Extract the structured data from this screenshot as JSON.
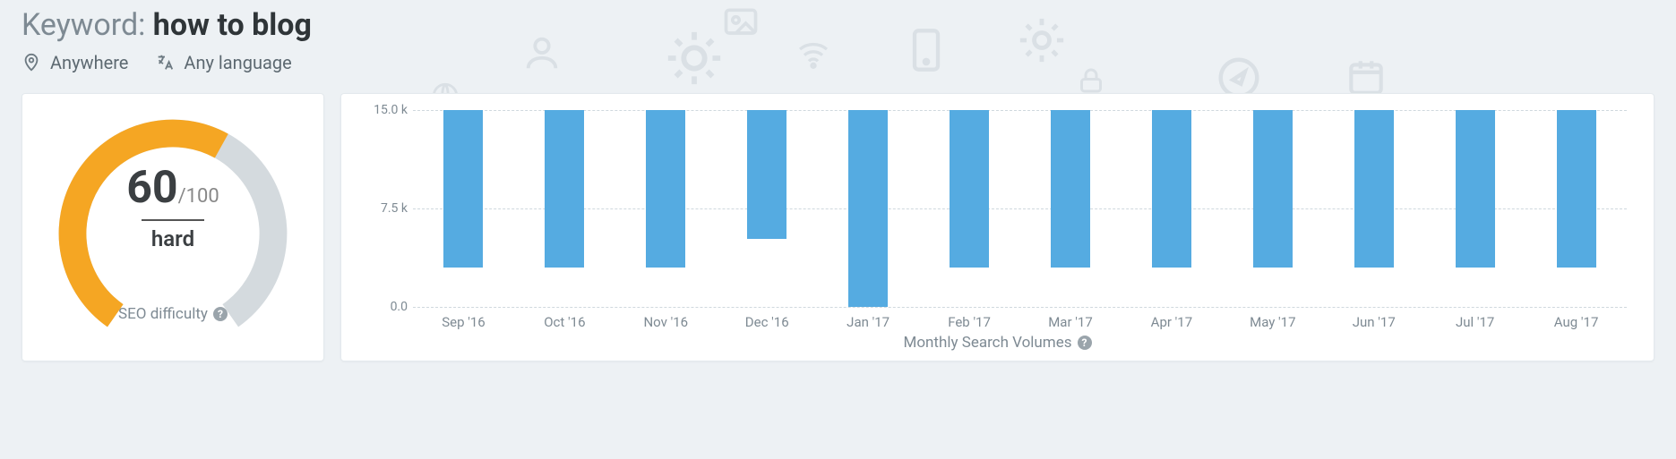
{
  "header": {
    "title_prefix": "Keyword: ",
    "keyword": "how to blog",
    "location_label": "Anywhere",
    "language_label": "Any language"
  },
  "gauge": {
    "score": "60",
    "max_suffix": "/100",
    "label": "hard",
    "caption": "SEO difficulty",
    "percent": 0.6
  },
  "chart": {
    "caption": "Monthly Search Volumes",
    "yticks": [
      {
        "v": 0.0,
        "label": "0.0"
      },
      {
        "v": 7.5,
        "label": "7.5 k"
      },
      {
        "v": 15.0,
        "label": "15.0 k"
      }
    ],
    "ymax": 15.0
  },
  "chart_data": {
    "type": "bar",
    "title": "Monthly Search Volumes",
    "xlabel": "",
    "ylabel": "",
    "ylim": [
      0,
      15
    ],
    "unit": "k",
    "categories": [
      "Sep '16",
      "Oct '16",
      "Nov '16",
      "Dec '16",
      "Jan '17",
      "Feb '17",
      "Mar '17",
      "Apr '17",
      "May '17",
      "Jun '17",
      "Jul '17",
      "Aug '17"
    ],
    "values": [
      12.0,
      12.0,
      12.0,
      9.8,
      15.0,
      12.0,
      12.0,
      12.0,
      12.0,
      12.0,
      12.0,
      12.0
    ]
  }
}
